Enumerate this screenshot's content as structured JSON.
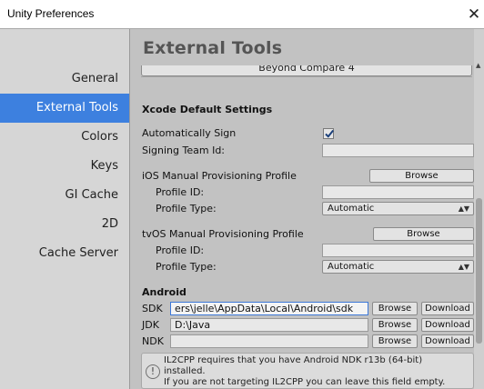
{
  "window": {
    "title": "Unity Preferences",
    "close_icon": "close-icon"
  },
  "sidebar": {
    "items": [
      {
        "label": "General"
      },
      {
        "label": "External Tools"
      },
      {
        "label": "Colors"
      },
      {
        "label": "Keys"
      },
      {
        "label": "GI Cache"
      },
      {
        "label": "2D"
      },
      {
        "label": "Cache Server"
      }
    ],
    "active_index": 1
  },
  "main": {
    "title": "External Tools",
    "cut_button_label": "Beyond Compare 4",
    "xcode": {
      "header": "Xcode Default Settings",
      "auto_sign_label": "Automatically Sign",
      "auto_sign_checked": true,
      "team_id_label": "Signing Team Id:",
      "team_id_value": ""
    },
    "ios": {
      "header": "iOS Manual Provisioning Profile",
      "browse_label": "Browse",
      "profile_id_label": "Profile ID:",
      "profile_id_value": "",
      "profile_type_label": "Profile Type:",
      "profile_type_value": "Automatic"
    },
    "tvos": {
      "header": "tvOS Manual Provisioning Profile",
      "browse_label": "Browse",
      "profile_id_label": "Profile ID:",
      "profile_id_value": "",
      "profile_type_label": "Profile Type:",
      "profile_type_value": "Automatic"
    },
    "android": {
      "header": "Android",
      "sdk_label": "SDK",
      "sdk_value": "ers\\jelle\\AppData\\Local\\Android\\sdk",
      "jdk_label": "JDK",
      "jdk_value": "D:\\Java",
      "ndk_label": "NDK",
      "ndk_value": "",
      "browse_label": "Browse",
      "download_label": "Download"
    },
    "help": {
      "line1": "IL2CPP requires that you have Android NDK r13b (64-bit)",
      "line2": "installed.",
      "line3": "If you are not targeting IL2CPP you can leave this field empty."
    }
  },
  "colors": {
    "accent": "#3d80df",
    "background": "#c2c2c2",
    "sidebar": "#d6d6d6"
  }
}
